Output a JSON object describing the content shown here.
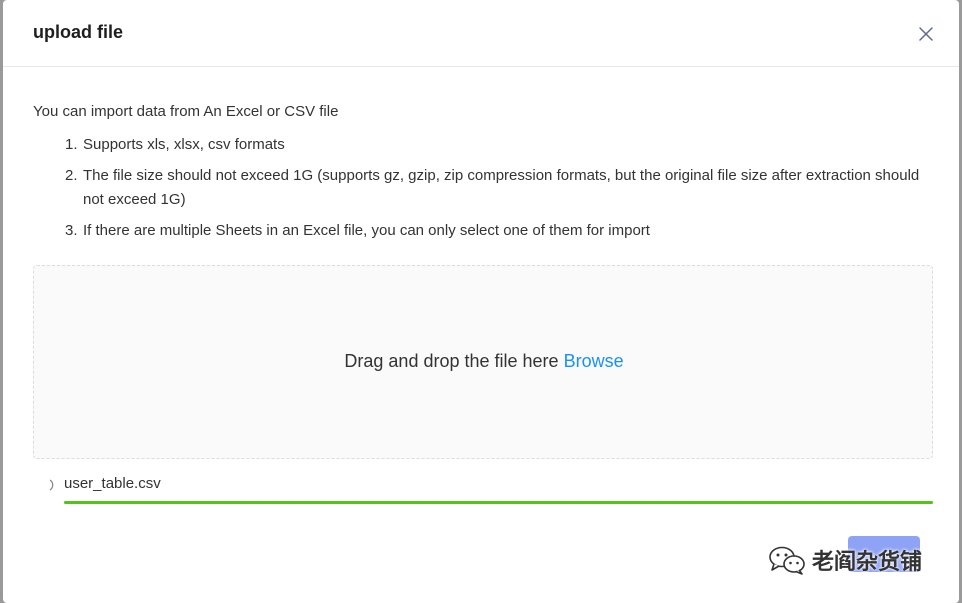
{
  "dialog": {
    "title": "upload file",
    "close_icon": "close-icon"
  },
  "body": {
    "intro": "You can import data from An Excel or CSV file",
    "rules": [
      {
        "num": "1.",
        "text": "Supports xls, xlsx, csv formats"
      },
      {
        "num": "2.",
        "text": "The file size should not exceed 1G (supports gz, gzip, zip compression formats, but the original file size after extraction should not exceed 1G)"
      },
      {
        "num": "3.",
        "text": "If there are multiple Sheets in an Excel file, you can only select one of them for import"
      }
    ],
    "dropzone": {
      "text": "Drag and drop the file here",
      "browse_label": "Browse"
    }
  },
  "upload_list": [
    {
      "name": "user_table.csv",
      "status_icon": "loading-icon",
      "progress": 1.0
    }
  ],
  "footer": {
    "button_label": ""
  },
  "watermark": {
    "icon": "wechat-icon",
    "text": "老阎杂货铺"
  },
  "colors": {
    "accent": "#1890ff",
    "progress": "#52c41a",
    "button": "#8ea3f5"
  }
}
